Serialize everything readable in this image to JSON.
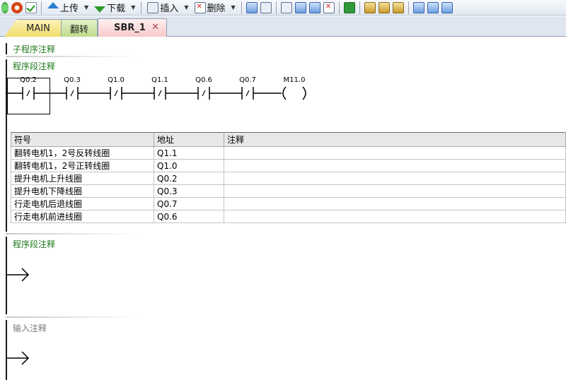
{
  "toolbar": {
    "upload_label": "上传",
    "download_label": "下载",
    "insert_label": "插入",
    "delete_label": "删除"
  },
  "tabs": [
    {
      "label": "MAIN"
    },
    {
      "label": "翻转"
    },
    {
      "label": "SBR_1"
    }
  ],
  "editor": {
    "subroutine_comment": "子程序注释",
    "networks": [
      {
        "comment": "程序段注释",
        "contacts": [
          "Q0.2",
          "Q0.3",
          "Q1.0",
          "Q1.1",
          "Q0.6",
          "Q0.7"
        ],
        "coil": "M11.0",
        "symbol_table": {
          "headers": [
            "符号",
            "地址",
            "注释"
          ],
          "rows": [
            {
              "symbol": "翻转电机1，2号反转线圈",
              "address": "Q1.1",
              "comment": ""
            },
            {
              "symbol": "翻转电机1，2号正转线圈",
              "address": "Q1.0",
              "comment": ""
            },
            {
              "symbol": "提升电机上升线圈",
              "address": "Q0.2",
              "comment": ""
            },
            {
              "symbol": "提升电机下降线圈",
              "address": "Q0.3",
              "comment": ""
            },
            {
              "symbol": "行走电机后退线圈",
              "address": "Q0.7",
              "comment": ""
            },
            {
              "symbol": "行走电机前进线圈",
              "address": "Q0.6",
              "comment": ""
            }
          ]
        }
      },
      {
        "comment": "程序段注释"
      },
      {
        "comment": "输入注释"
      }
    ]
  }
}
